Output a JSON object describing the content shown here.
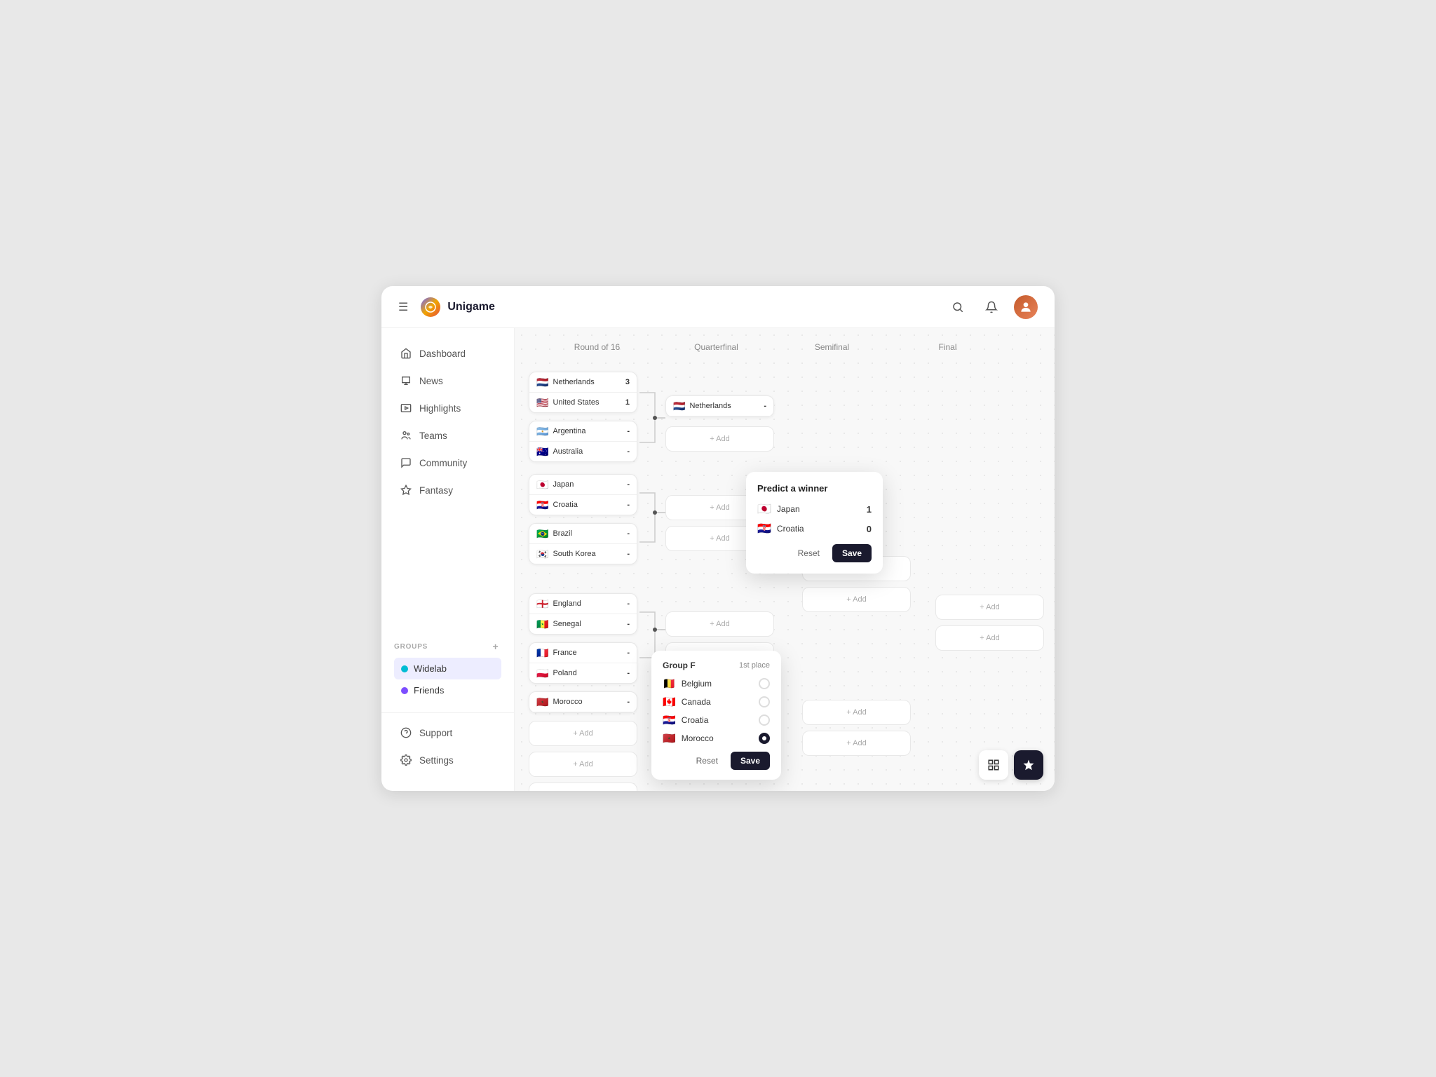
{
  "app": {
    "name": "Unigame",
    "hamburger_label": "☰"
  },
  "header": {
    "search_label": "🔍",
    "notification_label": "🔔",
    "avatar_label": "👤"
  },
  "nav": {
    "items": [
      {
        "id": "dashboard",
        "label": "Dashboard",
        "icon": "⌂"
      },
      {
        "id": "news",
        "label": "News",
        "icon": "📰"
      },
      {
        "id": "highlights",
        "label": "Highlights",
        "icon": "📹"
      },
      {
        "id": "teams",
        "label": "Teams",
        "icon": "👥"
      },
      {
        "id": "community",
        "label": "Community",
        "icon": "💬"
      },
      {
        "id": "fantasy",
        "label": "Fantasy",
        "icon": "⭐"
      }
    ]
  },
  "groups": {
    "label": "GROUPS",
    "add_btn": "+",
    "items": [
      {
        "id": "widelab",
        "label": "Widelab",
        "color": "#00bcd4"
      },
      {
        "id": "friends",
        "label": "Friends",
        "color": "#7c4dff"
      }
    ]
  },
  "sidebar_bottom": {
    "items": [
      {
        "id": "support",
        "label": "Support",
        "icon": "🎧"
      },
      {
        "id": "settings",
        "label": "Settings",
        "icon": "⚙"
      }
    ]
  },
  "bracket": {
    "columns": [
      "Round of 16",
      "Quarterfinal",
      "Semifinal",
      "Final"
    ],
    "matches": [
      {
        "id": "r16-1",
        "teams": [
          {
            "name": "Netherlands",
            "flag": "🇳🇱",
            "score": "3"
          },
          {
            "name": "United States",
            "flag": "🇺🇸",
            "score": "1"
          }
        ]
      },
      {
        "id": "r16-2",
        "teams": [
          {
            "name": "Argentina",
            "flag": "🇦🇷",
            "score": "-"
          },
          {
            "name": "Australia",
            "flag": "🇦🇺",
            "score": "-"
          }
        ]
      },
      {
        "id": "r16-3",
        "teams": [
          {
            "name": "Japan",
            "flag": "🇯🇵",
            "score": "-"
          },
          {
            "name": "Croatia",
            "flag": "🇭🇷",
            "score": "-"
          }
        ]
      },
      {
        "id": "r16-4",
        "teams": [
          {
            "name": "Brazil",
            "flag": "🇧🇷",
            "score": "-"
          },
          {
            "name": "South Korea",
            "flag": "🇰🇷",
            "score": "-"
          }
        ]
      },
      {
        "id": "r16-5",
        "teams": [
          {
            "name": "England",
            "flag": "🏴󠁧󠁢󠁥󠁮󠁧󠁿",
            "score": "-"
          },
          {
            "name": "Senegal",
            "flag": "🇸🇳",
            "score": "-"
          }
        ]
      },
      {
        "id": "r16-6",
        "teams": [
          {
            "name": "France",
            "flag": "🇫🇷",
            "score": "-"
          },
          {
            "name": "Poland",
            "flag": "🇵🇱",
            "score": "-"
          }
        ]
      },
      {
        "id": "r16-7",
        "teams": [
          {
            "name": "Morocco",
            "flag": "🇲🇦",
            "score": "-"
          }
        ]
      }
    ],
    "qf_matches": [
      {
        "id": "qf-1",
        "teams": [
          {
            "name": "Netherlands",
            "flag": "🇳🇱",
            "score": "-"
          },
          {
            "add": true
          }
        ]
      }
    ],
    "add_labels": {
      "add": "+ Add"
    }
  },
  "predict_popup": {
    "title": "Predict a winner",
    "teams": [
      {
        "name": "Japan",
        "flag": "🇯🇵",
        "score": "1"
      },
      {
        "name": "Croatia",
        "flag": "🇭🇷",
        "score": "0"
      }
    ],
    "reset_label": "Reset",
    "save_label": "Save"
  },
  "groupf_popup": {
    "title": "Group F",
    "subtitle": "1st place",
    "teams": [
      {
        "name": "Belgium",
        "flag": "🇧🇪",
        "selected": false
      },
      {
        "name": "Canada",
        "flag": "🇨🇦",
        "selected": false
      },
      {
        "name": "Croatia",
        "flag": "🇭🇷",
        "selected": false
      },
      {
        "name": "Morocco",
        "flag": "🇲🇦",
        "selected": true
      }
    ],
    "reset_label": "Reset",
    "save_label": "Save"
  },
  "fabs": {
    "secondary_icon": "☰",
    "primary_icon": "👑"
  }
}
